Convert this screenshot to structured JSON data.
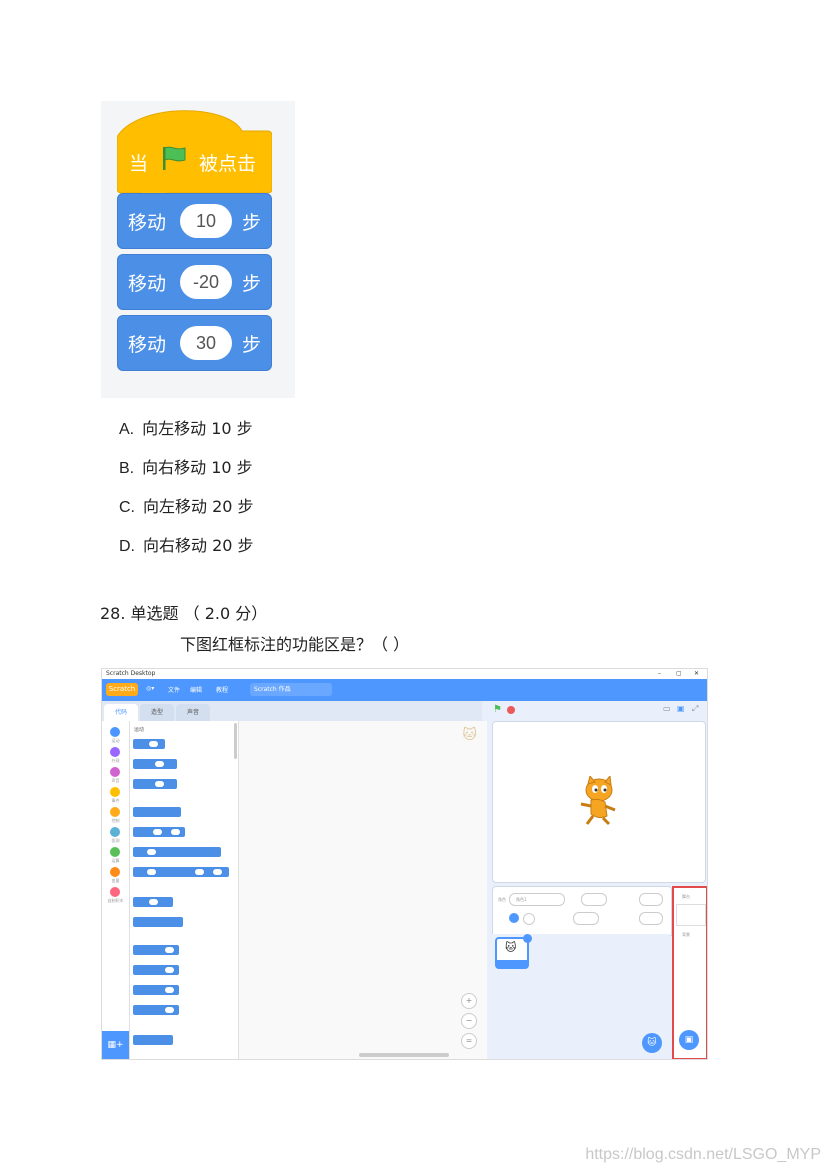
{
  "blocks": {
    "hat_prefix": "当",
    "hat_suffix": "被点击",
    "move_label": "移动",
    "unit": "步",
    "values": [
      "10",
      "-20",
      "30"
    ]
  },
  "options": [
    {
      "letter": "A.",
      "text": "向左移动 10 步"
    },
    {
      "letter": "B.",
      "text": "向右移动 10 步"
    },
    {
      "letter": "C.",
      "text": "向左移动 20 步"
    },
    {
      "letter": "D.",
      "text": "向右移动 20 步"
    }
  ],
  "question": {
    "number": "28. 单选题 （ 2.0 分）",
    "text": "下图红框标注的功能区是？（    ）"
  },
  "screenshot": {
    "window_title": "Scratch Desktop",
    "window_controls": [
      "–",
      "▢",
      "✕"
    ],
    "logo": "Scratch",
    "menu": [
      "文件",
      "编辑",
      "教程"
    ],
    "project_title": "Scratch 作品",
    "tabs": [
      "代码",
      "造型",
      "声音"
    ],
    "palette_header": "运动",
    "sprite_name": "角色1",
    "categories": [
      {
        "label": "运动",
        "color": "#4c97ff"
      },
      {
        "label": "外观",
        "color": "#9966ff"
      },
      {
        "label": "声音",
        "color": "#cf63cf"
      },
      {
        "label": "事件",
        "color": "#ffbf00"
      },
      {
        "label": "控制",
        "color": "#ffab19"
      },
      {
        "label": "侦测",
        "color": "#5cb1d6"
      },
      {
        "label": "运算",
        "color": "#59c059"
      },
      {
        "label": "变量",
        "color": "#ff8c1a"
      },
      {
        "label": "自制积木",
        "color": "#ff6680"
      }
    ],
    "stage_panel_label": "舞台",
    "backdrop_label": "背景",
    "highlight_color": "#e34b4b"
  },
  "watermark": "https://blog.csdn.net/LSGO_MYP"
}
